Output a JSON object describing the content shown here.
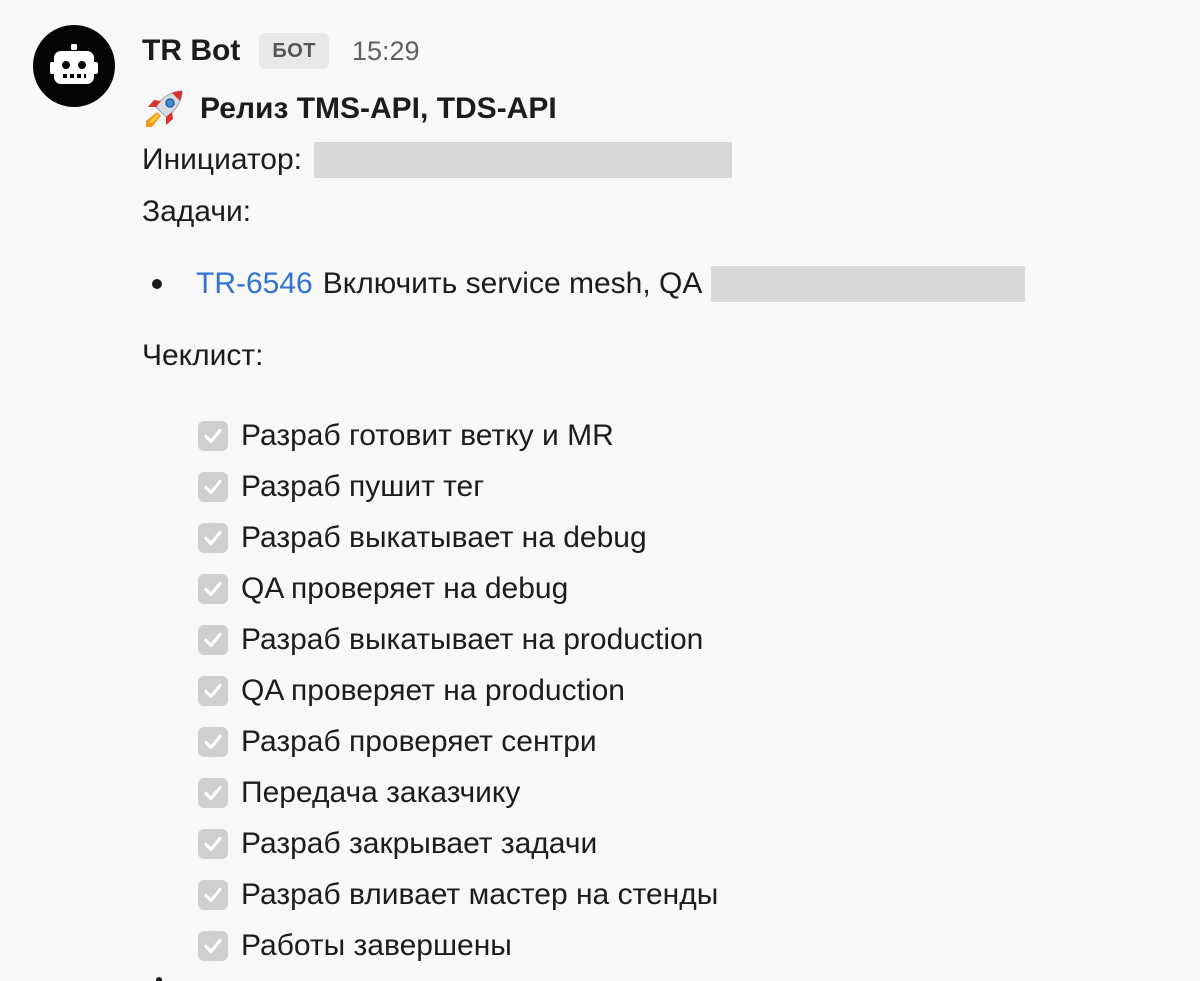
{
  "sender": {
    "name": "TR Bot",
    "badge": "БОТ",
    "time": "15:29",
    "avatar_icon": "robot-icon"
  },
  "message": {
    "title_icon": "rocket-icon",
    "title": "Релиз TMS-API, TDS-API",
    "initiator_label": "Инициатор:",
    "tasks_label": "Задачи:",
    "tasks": [
      {
        "id": "TR-6546",
        "text": "Включить service mesh, QA"
      }
    ],
    "checklist_label": "Чеклист:",
    "checklist": [
      {
        "label": "Разраб готовит ветку и MR",
        "checked": true
      },
      {
        "label": "Разраб пушит тег",
        "checked": true
      },
      {
        "label": "Разраб выкатывает на debug",
        "checked": true
      },
      {
        "label": "QA проверяет на debug",
        "checked": true
      },
      {
        "label": "Разраб выкатывает на production",
        "checked": true
      },
      {
        "label": "QA проверяет на production",
        "checked": true
      },
      {
        "label": "Разраб проверяет сентри",
        "checked": true
      },
      {
        "label": "Передача заказчику",
        "checked": true
      },
      {
        "label": "Разраб закрывает задачи",
        "checked": true
      },
      {
        "label": "Разраб вливает мастер на стенды",
        "checked": true
      },
      {
        "label": "Работы завершены",
        "checked": true
      }
    ]
  },
  "colors": {
    "link": "#2f74d0",
    "redaction": "#d8d8d8",
    "checkbox": "#cfcfcf",
    "background": "#f8f8f8"
  }
}
